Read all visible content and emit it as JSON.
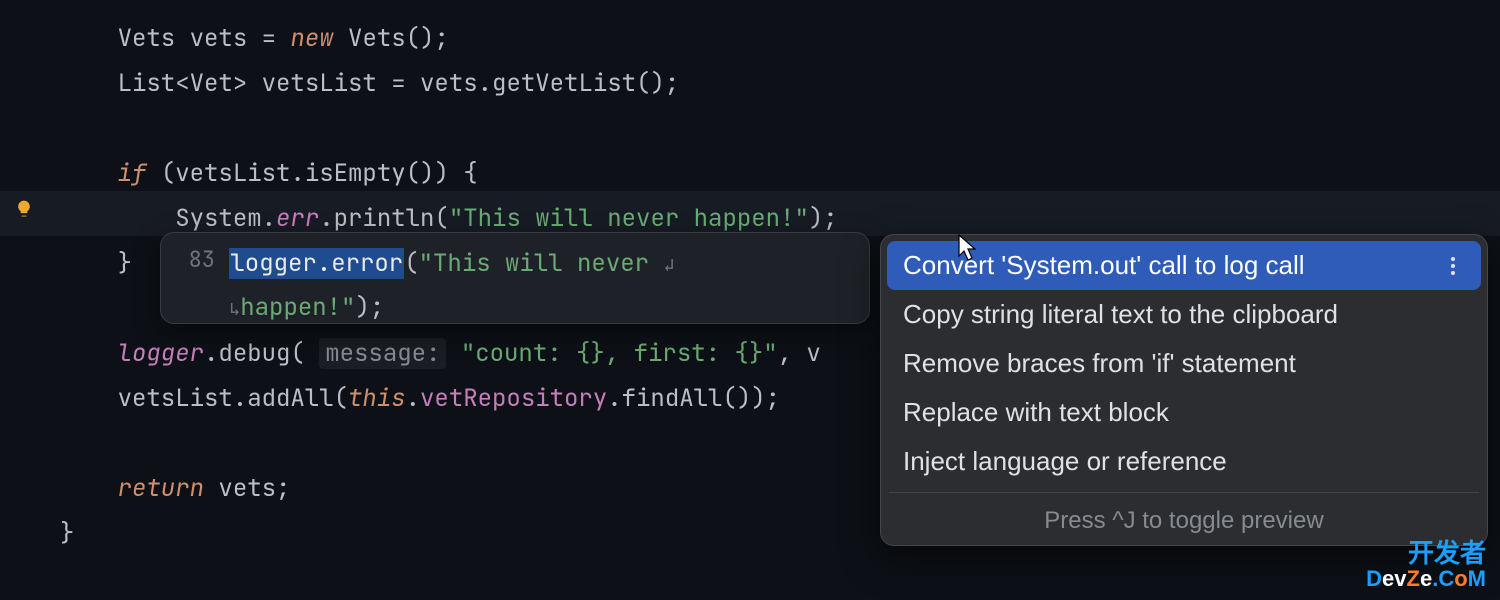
{
  "code": {
    "l1_vets_type": "Vets",
    "l1_vets_name": "vets",
    "l1_eq": " = ",
    "l1_new": "new",
    "l1_vets_ctor": "Vets",
    "l1_tail": "();",
    "l2_list": "List",
    "l2_open": "<",
    "l2_vet": "Vet",
    "l2_close": ">",
    "l2_name": " vetsList = vets.",
    "l2_method": "getVetList",
    "l2_tail": "();",
    "l4_if": "if",
    "l4_cond_open": " (vetsList.",
    "l4_isEmpty": "isEmpty",
    "l4_cond_close": "()) {",
    "l5_indent": "    ",
    "l5_system": "System.",
    "l5_err": "err",
    "l5_println": ".println(",
    "l5_str": "\"This will never happen!\"",
    "l5_tail": ");",
    "l6_brace": "}",
    "l8_logger": "logger",
    "l8_debug": ".debug( ",
    "l8_hint": "message:",
    "l8_str": " \"count: {}, first: {}\"",
    "l8_tail": ", v",
    "l9_pre": "vetsList.addAll(",
    "l9_this": "this",
    "l9_dot": ".",
    "l9_field": "vetRepository",
    "l9_find": ".findAll());",
    "l11_return": "return",
    "l11_vets": " vets;",
    "l12_brace": "}"
  },
  "preview": {
    "line_number": "83",
    "sel_text": "logger.error",
    "paren": "(",
    "str1": "\"This will never ",
    "wrap1": "↲",
    "wrap2": "↳",
    "str2": "happen!\"",
    "tail": ");"
  },
  "menu": {
    "items": [
      "Convert 'System.out' call to log call",
      "Copy string literal text to the clipboard",
      "Remove braces from 'if' statement",
      "Replace with text block",
      "Inject language or reference"
    ],
    "hint": "Press ^J to toggle preview"
  },
  "watermark": {
    "top": "开发者",
    "bot_d": "D",
    "bot_ev": "ev",
    "bot_z": "Z",
    "bot_e": "e",
    "bot_c": ".C",
    "bot_o": "o",
    "bot_m": "M"
  }
}
